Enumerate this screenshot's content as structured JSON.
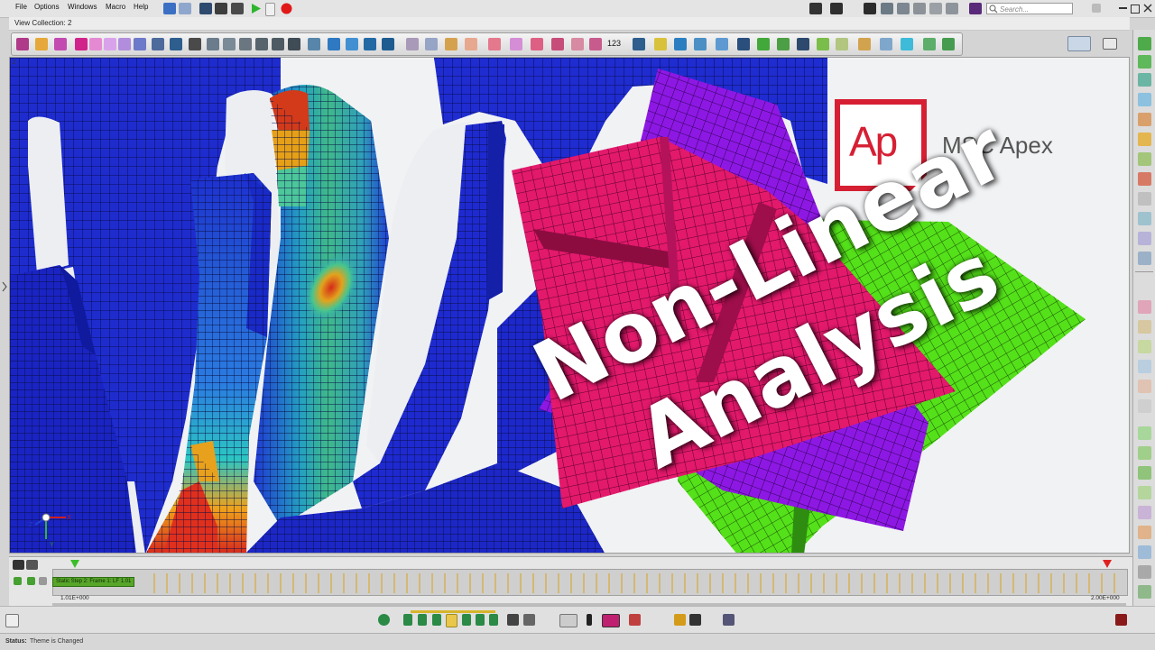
{
  "app": {
    "name": "MSC Apex"
  },
  "menu": {
    "items": [
      {
        "label": "File"
      },
      {
        "label": "Options"
      },
      {
        "label": "Windows"
      },
      {
        "label": "Macro"
      },
      {
        "label": "Help"
      }
    ]
  },
  "search": {
    "placeholder": "Search..."
  },
  "view": {
    "tab_label": "View Collection: 2",
    "axis_label": "Z"
  },
  "toolbar": {
    "count_label": "123"
  },
  "logo": {
    "mark": "Ap",
    "text": "MSC Apex"
  },
  "hero": {
    "line1": "Non-Linear",
    "line2": "Analysis"
  },
  "timeline": {
    "step_label": "Static Step 2: Frame 1: LF 1.01",
    "start_value": "1.01E+000",
    "end_value": "2.00E+000"
  },
  "status": {
    "label": "Status:",
    "text": "Theme is Changed"
  },
  "colors": {
    "accent": "#d61f33",
    "mesh_blue": "#1f2cd0",
    "mesh_magenta": "#e3196c",
    "mesh_purple": "#8e18e3",
    "mesh_green": "#54e11a",
    "play_green": "#2db52d",
    "record_red": "#e01818"
  },
  "icons": [
    "undo-icon",
    "redo-icon",
    "save-icon",
    "run-icon",
    "record-icon",
    "camera-icon",
    "search-icon",
    "play-icon",
    "pause-icon",
    "rewind-icon",
    "forward-icon"
  ]
}
